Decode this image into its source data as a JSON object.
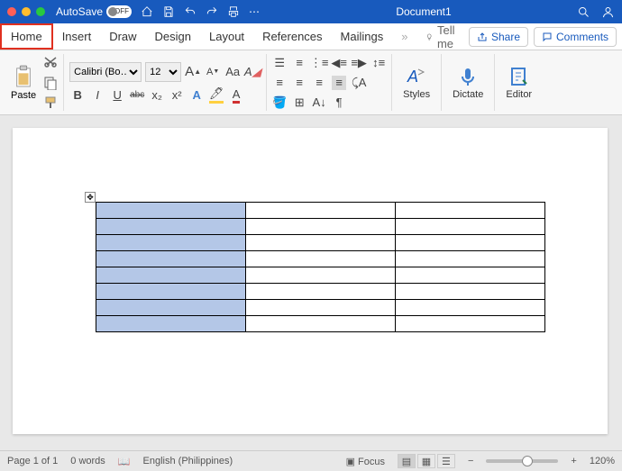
{
  "title": {
    "autosave_label": "AutoSave",
    "autosave_state": "OFF",
    "doc_name": "Document1"
  },
  "tabs": {
    "items": [
      "Home",
      "Insert",
      "Draw",
      "Design",
      "Layout",
      "References",
      "Mailings"
    ],
    "active_index": 0,
    "tell_me": "Tell me",
    "share": "Share",
    "comments": "Comments"
  },
  "ribbon": {
    "paste": "Paste",
    "font_name": "Calibri (Bo…",
    "font_size": "12",
    "styles": "Styles",
    "dictate": "Dictate",
    "editor": "Editor",
    "bold": "B",
    "italic": "I",
    "underline": "U",
    "strike": "abc",
    "sub": "x₂",
    "sup": "x²",
    "grow": "A",
    "shrink": "A",
    "case": "Aa"
  },
  "table": {
    "rows": 8,
    "cols": 3,
    "selected_col": 0
  },
  "status": {
    "page": "Page 1 of 1",
    "words": "0 words",
    "language": "English (Philippines)",
    "focus": "Focus",
    "zoom": "120%",
    "minus": "−",
    "plus": "+"
  }
}
